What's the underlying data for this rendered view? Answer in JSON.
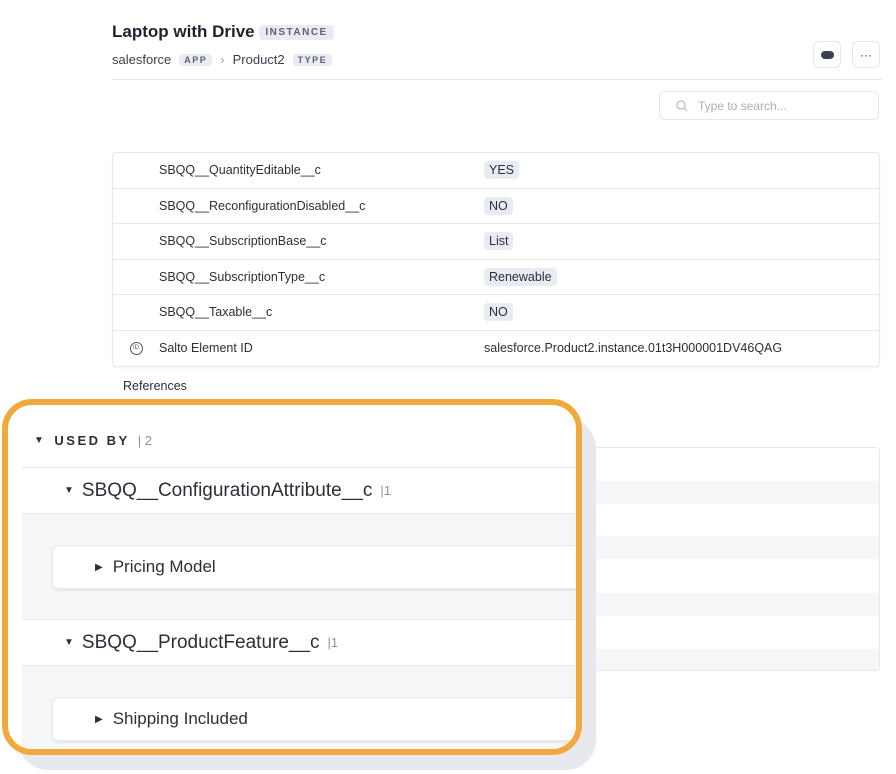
{
  "header": {
    "title": "Laptop with Drive",
    "title_badge": "INSTANCE",
    "app": "salesforce",
    "app_badge": "APP",
    "type": "Product2",
    "type_badge": "TYPE",
    "separator": "›",
    "more_label": "···"
  },
  "search": {
    "placeholder": "Type to search..."
  },
  "fields": [
    {
      "key": "SBQQ__QuantityEditable__c",
      "value": "YES"
    },
    {
      "key": "SBQQ__ReconfigurationDisabled__c",
      "value": "NO"
    },
    {
      "key": "SBQQ__SubscriptionBase__c",
      "value": "List"
    },
    {
      "key": "SBQQ__SubscriptionType__c",
      "value": "Renewable"
    },
    {
      "key": "SBQQ__Taxable__c",
      "value": "NO"
    }
  ],
  "element_id": {
    "icon_text": "ID",
    "label": "Salto Element ID",
    "value": "salesforce.Product2.instance.01t3H000001DV46QAG"
  },
  "references": {
    "label": "References",
    "used_by": {
      "label": "USED BY",
      "count": "| 2",
      "groups": [
        {
          "name": "SBQQ__ConfigurationAttribute__c",
          "count": "|1",
          "items": [
            "Pricing Model"
          ]
        },
        {
          "name": "SBQQ__ProductFeature__c",
          "count": "|1",
          "items": [
            "Shipping Included"
          ]
        }
      ]
    }
  },
  "colors": {
    "highlight": "#F2A93B"
  }
}
